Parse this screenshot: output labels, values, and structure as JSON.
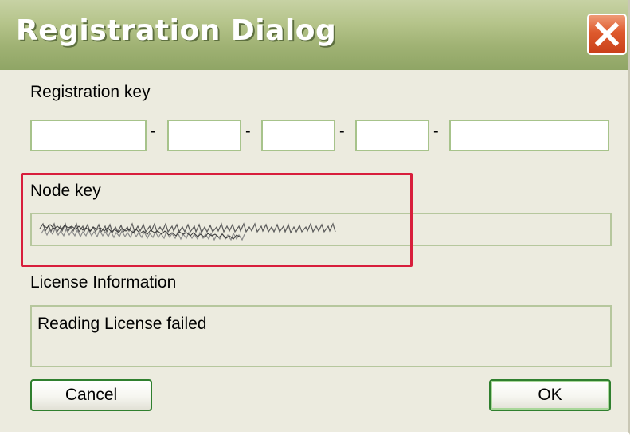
{
  "window": {
    "title": "Registration Dialog",
    "close_icon": "close-icon"
  },
  "registration": {
    "label": "Registration key",
    "separator": "-",
    "fields": [
      "",
      "",
      "",
      "",
      ""
    ]
  },
  "node_key": {
    "label": "Node key",
    "value_obscured": true
  },
  "license": {
    "label": "License Information",
    "text": "Reading License failed"
  },
  "buttons": {
    "cancel": "Cancel",
    "ok": "OK"
  },
  "colors": {
    "title_bar": "#a0b274",
    "dialog_bg": "#ecebdf",
    "close_button": "#de5a2d",
    "field_border": "#a7c38b",
    "highlight": "#d81e3c",
    "button_border": "#2f7f2e"
  }
}
